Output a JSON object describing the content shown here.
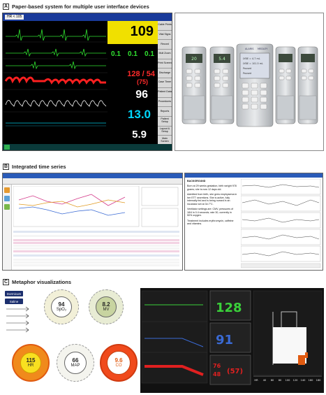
{
  "sections": [
    {
      "letter": "A",
      "title": "Paper-based system for multiple user interface devices"
    },
    {
      "letter": "B",
      "title": "Integrated time series"
    },
    {
      "letter": "C",
      "title": "Metaphor visualizations"
    }
  ],
  "monitor": {
    "topbar_field": "HR < 105",
    "hr": {
      "value": "109"
    },
    "st_values": [
      "0.1",
      "0.1",
      "0.1"
    ],
    "bp": {
      "value": "128 / 54",
      "mean": "(75)"
    },
    "spo2": {
      "value": "96"
    },
    "rr": {
      "value": "13.0"
    },
    "temp": {
      "value": "5.9"
    },
    "buttons": [
      "Cable Prints",
      "Vital Signs",
      "Record",
      "Mult Zoom",
      "Print Screen",
      "Discharge",
      "Case Timer",
      "Patient Data",
      "Procedures",
      "Reports",
      "Patient Setup",
      "Layout & Setup",
      "Main Screen"
    ],
    "colors": {
      "hr_box": "#f0e000",
      "st": "#30e030",
      "bp": "#ff2a2a",
      "rr": "#00d8ff"
    }
  },
  "pumps": {
    "center_lines": [
      "LYBE = 4.7 mL",
      "LYBE = 101.5 mL",
      "Paused",
      "Paused"
    ],
    "brand_left": "ALARIS",
    "brand_right": "MEDLEY"
  },
  "patient": {
    "heading": "BACKGROUND",
    "paragraphs": [
      "Born at 29 weeks gestation, birth weight 978 grams; she is now 12 days old.",
      "Admitted from birth, she grew emphysema in her ETT secretions. She is active, fully internally fed and is being nursed in an incubator set at 34.7°C.",
      "Ventilator settings are: CMV, pressures of 18/4 in 0.4 seconds; rate 30, currently in 50% oxygen.",
      "Treatment includes erythromycin, caffeine and vitamins."
    ]
  },
  "metaphor": {
    "drugs": [
      "Dormicum",
      "Saline"
    ],
    "dials": [
      {
        "value": "94",
        "label": "SpO₂"
      },
      {
        "value": "8.2",
        "label": "MV"
      },
      {
        "value": "115",
        "label": "HR"
      },
      {
        "value": "66",
        "label": "MAP"
      },
      {
        "value": "9.6",
        "label": "CO"
      }
    ]
  },
  "metaphor_monitor": {
    "hr": "128",
    "spo2": "91",
    "bp_sys": "76",
    "bp_dia": "48",
    "bp_mean": "(57)",
    "axis_ticks": [
      "HR",
      "40",
      "60",
      "80",
      "100",
      "120",
      "140",
      "160",
      "180"
    ]
  }
}
